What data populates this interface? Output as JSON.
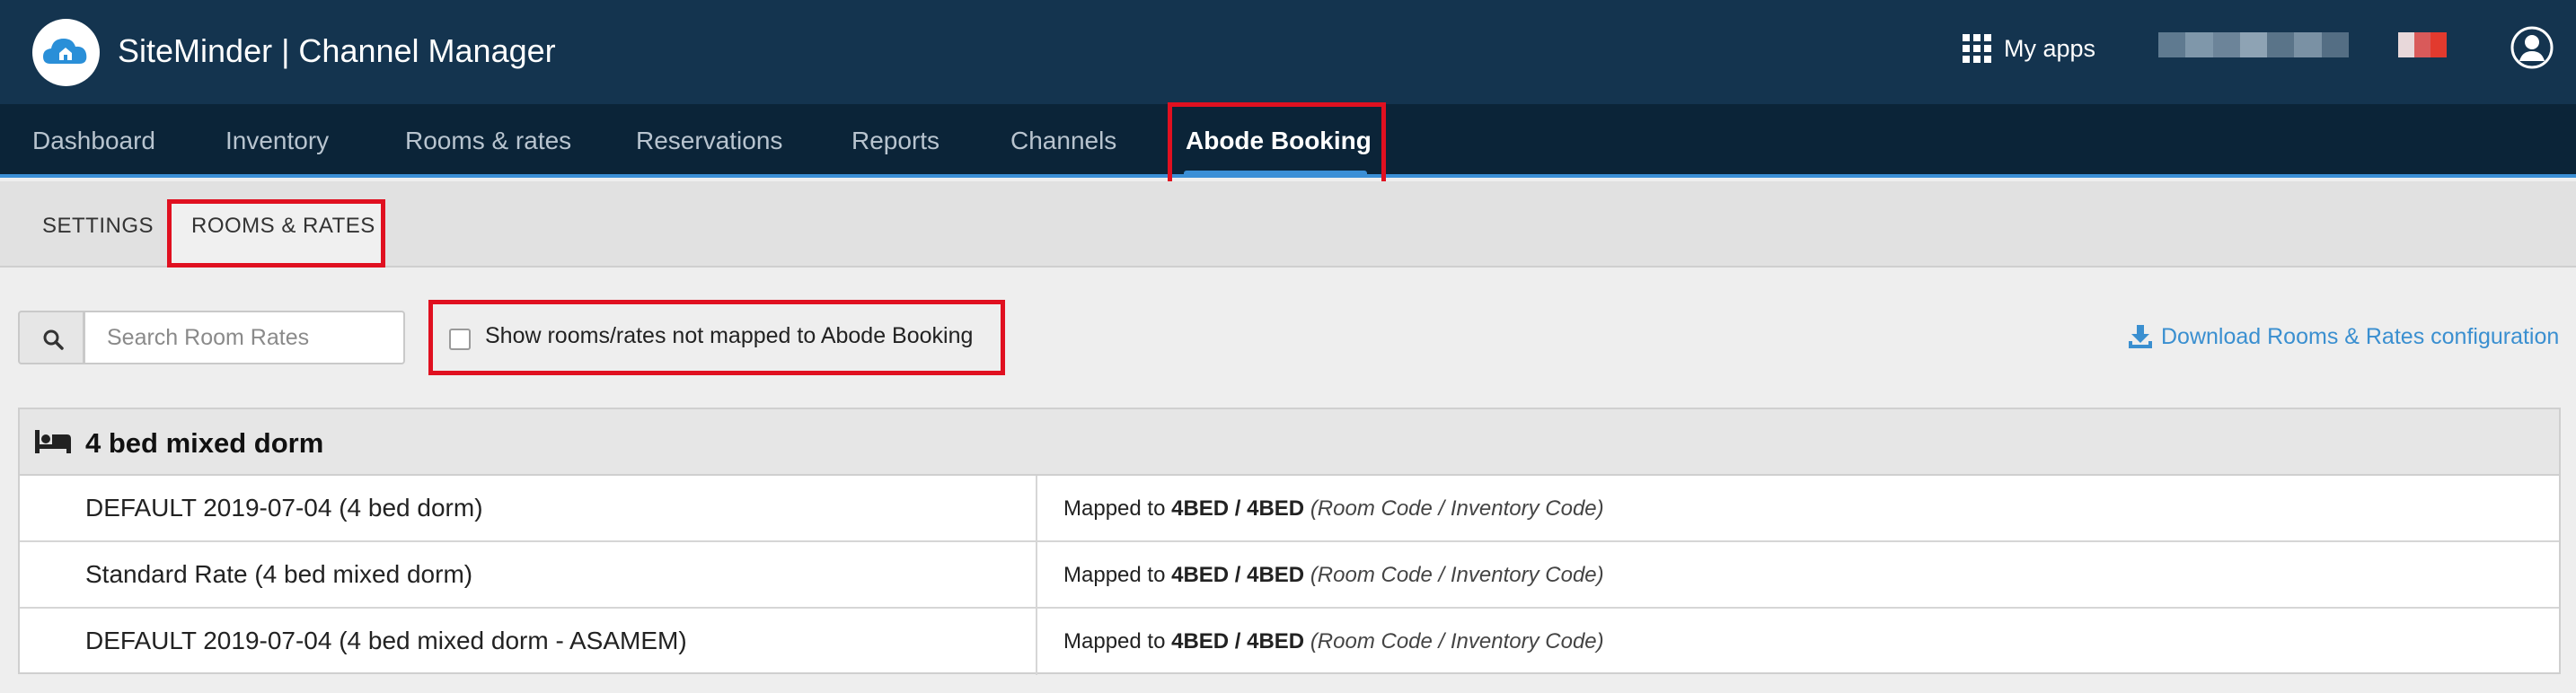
{
  "header": {
    "app_title": "SiteMinder | Channel Manager",
    "my_apps_label": "My apps",
    "logo_icon": "cloud-house-icon",
    "user_icon": "user-circle-icon"
  },
  "nav": {
    "items": [
      {
        "label": "Dashboard"
      },
      {
        "label": "Inventory"
      },
      {
        "label": "Rooms & rates"
      },
      {
        "label": "Reservations"
      },
      {
        "label": "Reports"
      },
      {
        "label": "Channels"
      },
      {
        "label": "Abode Booking"
      }
    ],
    "active": "Abode Booking"
  },
  "subnav": {
    "items": [
      {
        "label": "SETTINGS"
      },
      {
        "label": "ROOMS & RATES"
      }
    ],
    "active": "ROOMS & RATES"
  },
  "toolbar": {
    "search_placeholder": "Search Room Rates",
    "search_value": "",
    "show_unmapped_label": "Show rooms/rates not mapped to Abode Booking",
    "show_unmapped_checked": false,
    "download_label": "Download Rooms & Rates configuration"
  },
  "room_group": {
    "title": "4 bed mixed dorm",
    "icon": "bed-icon",
    "rows": [
      {
        "name": "DEFAULT 2019-07-04 (4 bed dorm)",
        "mapped_prefix": "Mapped to",
        "codes": "4BED / 4BED",
        "code_note": "(Room Code / Inventory Code)"
      },
      {
        "name": "Standard Rate (4 bed mixed dorm)",
        "mapped_prefix": "Mapped to",
        "codes": "4BED / 4BED",
        "code_note": "(Room Code / Inventory Code)"
      },
      {
        "name": "DEFAULT 2019-07-04 (4 bed mixed dorm - ASAMEM)",
        "mapped_prefix": "Mapped to",
        "codes": "4BED / 4BED",
        "code_note": "(Room Code / Inventory Code)"
      }
    ]
  },
  "colors": {
    "header_bg": "#14344f",
    "nav_bg": "#0b2438",
    "accent": "#3b8fd6",
    "link": "#3a8fd0",
    "highlight": "#e01020"
  }
}
